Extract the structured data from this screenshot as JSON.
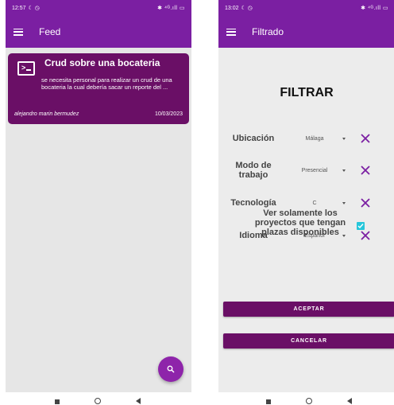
{
  "feed_screen": {
    "status": {
      "time": "12:57",
      "icons_left": "☾ ◷",
      "icons_right": "✱ ⁴ᴳ.ıll ▭"
    },
    "appbar": {
      "title": "Feed"
    },
    "card": {
      "title": "Crud sobre una bocateria",
      "description": "se necesita personal para realizar un crud de una bocateria la cual debería sacar un reporte del ...",
      "author": "alejandro marin bermudez",
      "date": "10/03/2023"
    },
    "colors": {
      "primary": "#7b1fa2",
      "card": "#6a0f66",
      "fab": "#8e24aa"
    },
    "icons": {
      "menu": "menu-icon",
      "card": "terminal-icon",
      "fab": "search-icon"
    }
  },
  "filter_screen": {
    "status": {
      "time": "13:02",
      "icons_left": "☾ ◷",
      "icons_right": "✱ ⁴ᴳ.ıll ▭"
    },
    "appbar": {
      "title": "Filtrado"
    },
    "heading": "FILTRAR",
    "filters": [
      {
        "label": "Ubicación",
        "value": "Málaga"
      },
      {
        "label": "Modo de trabajo",
        "value": "Presencial"
      },
      {
        "label": "Tecnología",
        "value": "C"
      },
      {
        "label": "Idioma",
        "value": "Español"
      }
    ],
    "checkbox": {
      "label": "Ver solamente los proyectos que tengan plazas disponibles",
      "checked": true
    },
    "buttons": {
      "accept": "ACEPTAR",
      "cancel": "CANCELAR"
    },
    "colors": {
      "primary": "#7b1fa2",
      "clear_icon": "#7b1fa2",
      "checkbox": "#26c6da"
    }
  }
}
